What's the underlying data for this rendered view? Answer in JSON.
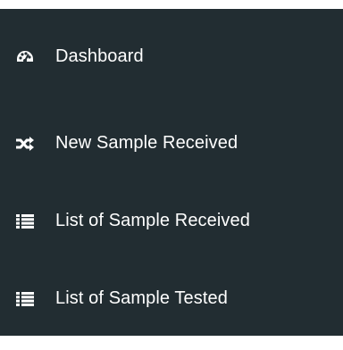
{
  "sidebar": {
    "items": [
      {
        "label": "Dashboard",
        "icon": "dashboard-icon"
      },
      {
        "label": "New Sample Received",
        "icon": "random-icon"
      },
      {
        "label": "List of Sample Received",
        "icon": "list-icon"
      },
      {
        "label": "List of Sample Tested",
        "icon": "list-icon"
      }
    ]
  },
  "colors": {
    "sidebar_bg": "#222d32",
    "text": "#ffffff",
    "icon": "#ffffff"
  }
}
